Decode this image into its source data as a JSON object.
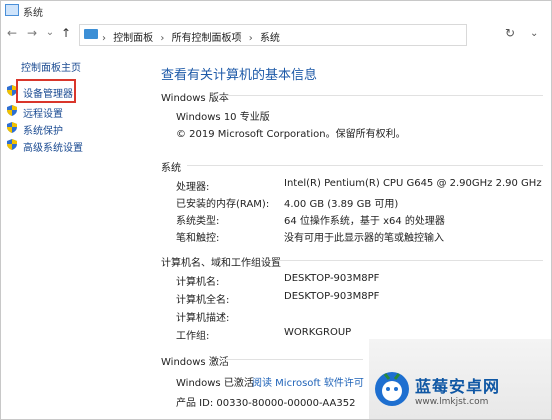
{
  "window": {
    "title": "系统"
  },
  "nav": {
    "back": "←",
    "forward": "→",
    "dropdown": "⌄",
    "up": "↑",
    "refresh": "↻"
  },
  "breadcrumb": {
    "sep": "›",
    "items": [
      "控制面板",
      "所有控制面板项",
      "系统"
    ],
    "dropdown": "⌄"
  },
  "sidebar": {
    "home": "控制面板主页",
    "items": [
      {
        "label": "设备管理器",
        "icon": "shield-icon"
      },
      {
        "label": "远程设置",
        "icon": "shield-icon"
      },
      {
        "label": "系统保护",
        "icon": "shield-icon"
      },
      {
        "label": "高级系统设置",
        "icon": "shield-icon"
      }
    ],
    "highlight_color": "#d9362b"
  },
  "main": {
    "heading": "查看有关计算机的基本信息",
    "edition": {
      "title": "Windows 版本",
      "name": "Windows 10 专业版",
      "copyright": "© 2019 Microsoft Corporation。保留所有权利。"
    },
    "system": {
      "title": "系统",
      "rows": [
        {
          "label": "处理器:",
          "value": "Intel(R) Pentium(R) CPU G645 @ 2.90GHz   2.90 GHz"
        },
        {
          "label": "已安装的内存(RAM):",
          "value": "4.00 GB (3.89 GB 可用)"
        },
        {
          "label": "系统类型:",
          "value": "64 位操作系统，基于 x64 的处理器"
        },
        {
          "label": "笔和触控:",
          "value": "没有可用于此显示器的笔或触控输入"
        }
      ]
    },
    "computer": {
      "title": "计算机名、域和工作组设置",
      "rows": [
        {
          "label": "计算机名:",
          "value": "DESKTOP-903M8PF"
        },
        {
          "label": "计算机全名:",
          "value": "DESKTOP-903M8PF"
        },
        {
          "label": "计算机描述:",
          "value": ""
        },
        {
          "label": "工作组:",
          "value": "WORKGROUP"
        }
      ]
    },
    "activation": {
      "title": "Windows 激活",
      "status": "Windows 已激活",
      "link": "阅读 Microsoft 软件许可",
      "product_id": "产品 ID: 00330-80000-00000-AA352"
    }
  },
  "watermark": {
    "name": "蓝莓安卓网",
    "url": "www.lmkjst.com"
  },
  "colors": {
    "link": "#1f63b8",
    "heading": "#1e5aa8",
    "nav_link": "#1a4a91"
  }
}
